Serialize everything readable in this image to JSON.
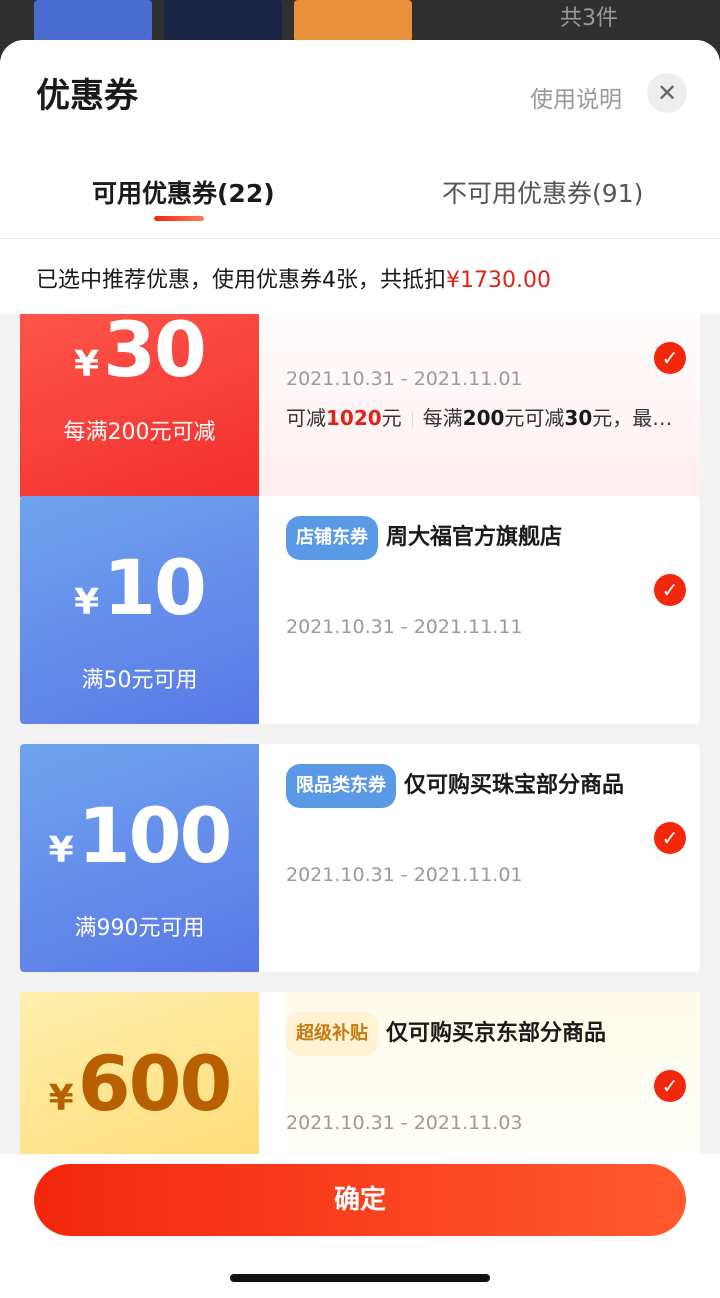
{
  "background": {
    "count_text": "共3件"
  },
  "header": {
    "title": "优惠券",
    "help": "使用说明",
    "close_glyph": "✕"
  },
  "tabs": [
    {
      "label": "可用优惠券(22)"
    },
    {
      "label": "不可用优惠券(91)"
    }
  ],
  "summary": {
    "text": "已选中推荐优惠，使用优惠券4张，共抵扣",
    "amount": "¥1730.00"
  },
  "coupons": [
    {
      "yen": "¥",
      "value": "30",
      "condition": "每满200元可减",
      "date": "2021.10.31 - 2021.11.01",
      "desc_prefix": "可减",
      "desc_amount": "1020",
      "desc_unit": "元",
      "desc_rest_a": "每满",
      "desc_rest_b": "200",
      "desc_rest_c": "元可减",
      "desc_rest_d": "30",
      "desc_rest_e": "元，最…",
      "checked": true
    },
    {
      "yen": "¥",
      "value": "10",
      "condition": "满50元可用",
      "tag": "店铺东券",
      "title": "周大福官方旗舰店",
      "date": "2021.10.31 - 2021.11.11",
      "checked": true
    },
    {
      "yen": "¥",
      "value": "100",
      "condition": "满990元可用",
      "tag": "限品类东券",
      "title": "仅可购买珠宝部分商品",
      "date": "2021.10.31 - 2021.11.01",
      "checked": true
    },
    {
      "yen": "¥",
      "value": "600",
      "tag": "超级补贴",
      "title": "仅可购买京东部分商品",
      "date": "2021.10.31 - 2021.11.03",
      "checked": true
    }
  ],
  "check_glyph": "✓",
  "footer": {
    "confirm": "确定"
  },
  "colors": {
    "accent": "#f2270c",
    "blue": "#5a78e6",
    "gold": "#ffd86a"
  }
}
